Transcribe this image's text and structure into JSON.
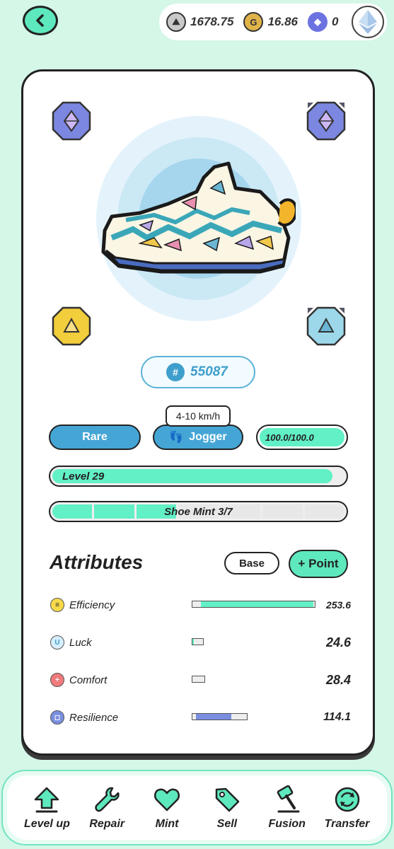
{
  "header": {
    "back_icon": "chevron-left-icon",
    "currencies": [
      {
        "icon": "gst-token-icon",
        "value": "1678.75"
      },
      {
        "icon": "gmt-token-icon",
        "value": "16.86"
      },
      {
        "icon": "eth-token-icon",
        "value": "0"
      }
    ],
    "avatar_icon": "eth-avatar-icon"
  },
  "sneaker": {
    "id": "55087",
    "id_prefix": "#",
    "quality": "Rare",
    "type": "Jogger",
    "speed_range": "4-10 km/h",
    "durability": "100.0/100.0",
    "level_label": "Level 29",
    "level_progress": 0.96,
    "mint_label": "Shoe Mint 3/7",
    "mint_done": 3,
    "mint_total": 7,
    "sockets": [
      "purple-gem-socket",
      "purple-gem-socket-locked",
      "yellow-gem-socket",
      "blue-gem-socket-locked"
    ]
  },
  "attributes": {
    "title": "Attributes",
    "base_label": "Base",
    "point_label": "+ Point",
    "items": [
      {
        "name": "Efficiency",
        "value": "253.6",
        "color": "#62f0c6",
        "icon_color": "#f7d94a",
        "fill": 0.98
      },
      {
        "name": "Luck",
        "value": "24.6",
        "color": "#62f0c6",
        "icon_color": "#d6efff",
        "fill": 0.12
      },
      {
        "name": "Comfort",
        "value": "28.4",
        "color": "#f08080",
        "icon_color": "#f07b7b",
        "fill": 0
      },
      {
        "name": "Resilience",
        "value": "114.1",
        "color": "#7a8fe0",
        "icon_color": "#7a8fe0",
        "fill": 0.65
      }
    ]
  },
  "actions": [
    {
      "label": "Level up",
      "icon": "level-up-arrow-icon"
    },
    {
      "label": "Repair",
      "icon": "wrench-icon"
    },
    {
      "label": "Mint",
      "icon": "heart-icon"
    },
    {
      "label": "Sell",
      "icon": "tag-icon"
    },
    {
      "label": "Fusion",
      "icon": "hammer-icon"
    },
    {
      "label": "Transfer",
      "icon": "transfer-icon"
    }
  ],
  "colors": {
    "mint": "#5ee8bd",
    "blue": "#45a6d6",
    "background": "#d4f7e8"
  }
}
